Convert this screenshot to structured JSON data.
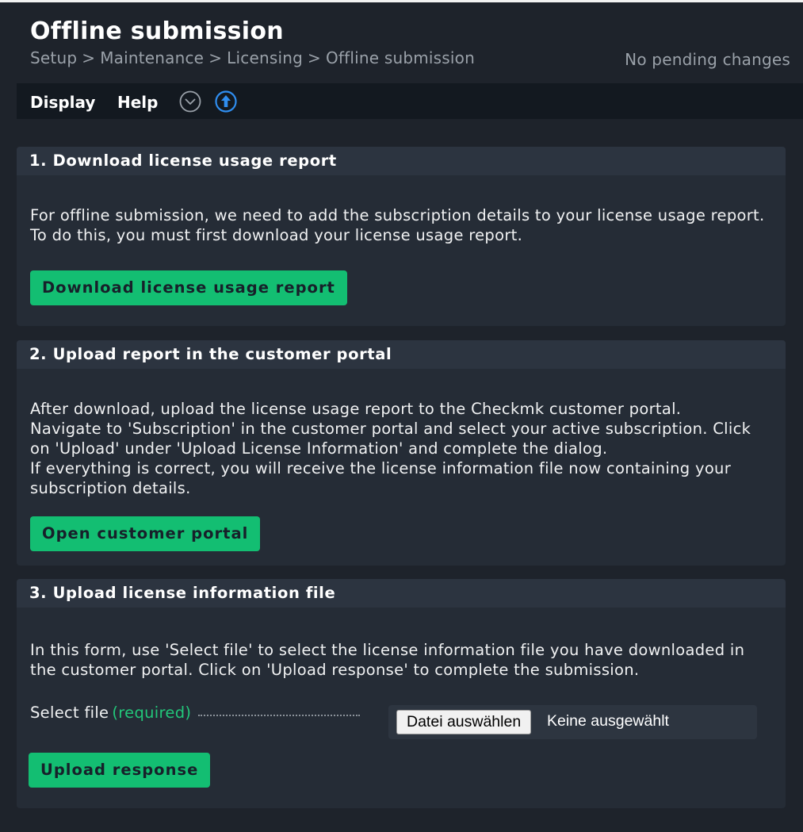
{
  "header": {
    "title": "Offline submission",
    "breadcrumb": [
      "Setup",
      "Maintenance",
      "Licensing",
      "Offline submission"
    ],
    "breadcrumb_separator": ">",
    "pending_changes": "No pending changes"
  },
  "menubar": {
    "display_label": "Display",
    "help_label": "Help",
    "icons": [
      "chevron-down-circle-icon",
      "upload-arrow-circle-icon"
    ]
  },
  "sections": [
    {
      "title": "1. Download license usage report",
      "paragraphs": [
        "For offline submission, we need to add the subscription details to your license usage report.",
        "To do this, you must first download your license usage report."
      ],
      "button": "Download license usage report"
    },
    {
      "title": "2. Upload report in the customer portal",
      "paragraphs": [
        "After download, upload the license usage report to the Checkmk customer portal.",
        "Navigate to 'Subscription' in the customer portal and select your active subscription. Click on 'Upload' under 'Upload License Information' and complete the dialog.",
        "If everything is correct, you will receive the license information file now containing your subscription details."
      ],
      "button": "Open customer portal"
    },
    {
      "title": "3. Upload license information file",
      "paragraphs": [
        "In this form, use 'Select file' to select the license information file you have downloaded in the customer portal. Click on 'Upload response' to complete the submission."
      ],
      "form": {
        "label": "Select file",
        "required": "(required)",
        "file_button": "Datei auswählen",
        "file_status": "Keine ausgewählt"
      },
      "button": "Upload response"
    }
  ],
  "colors": {
    "background": "#1e232b",
    "section_header": "#2c3440",
    "section_body": "#252c36",
    "accent_green": "#13be72",
    "menubar": "#131920",
    "help_icon_blue": "#2f8ef0"
  }
}
